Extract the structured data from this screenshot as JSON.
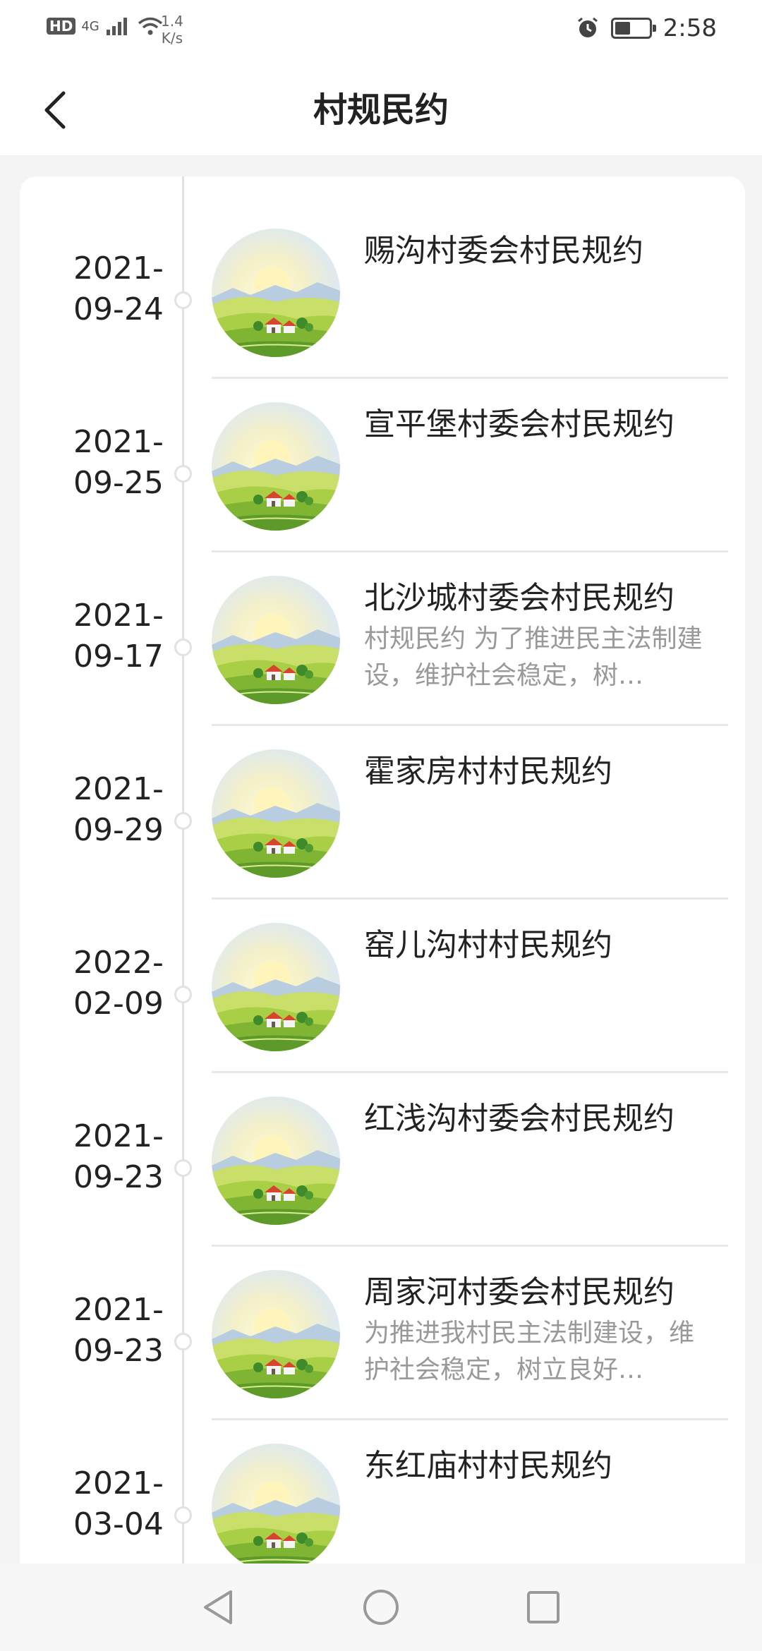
{
  "status_bar": {
    "hd": "HD",
    "network": "4G",
    "speed_value": "1.4",
    "speed_unit": "K/s",
    "time": "2:58",
    "battery_level": 0.45
  },
  "header": {
    "title": "村规民约",
    "back_icon": "chevron-left-icon"
  },
  "items": [
    {
      "date": "2021-\n09-24",
      "title": "赐沟村委会村民规约",
      "desc": ""
    },
    {
      "date": "2021-\n09-25",
      "title": "宣平堡村委会村民规约",
      "desc": ""
    },
    {
      "date": "2021-\n09-17",
      "title": "北沙城村委会村民规约",
      "desc": "村规民约 为了推进民主法制建设，维护社会稳定，树…"
    },
    {
      "date": "2021-\n09-29",
      "title": "霍家房村村民规约",
      "desc": ""
    },
    {
      "date": "2022-\n02-09",
      "title": "窑儿沟村村民规约",
      "desc": ""
    },
    {
      "date": "2021-\n09-23",
      "title": "红浅沟村委会村民规约",
      "desc": ""
    },
    {
      "date": "2021-\n09-23",
      "title": "周家河村委会村民规约",
      "desc": "为推进我村民主法制建设，维护社会稳定，树立良好…"
    },
    {
      "date": "2021-\n03-04",
      "title": "东红庙村村民规约",
      "desc": ""
    }
  ],
  "nav": {
    "back_icon": "triangle-back-icon",
    "home_icon": "circle-home-icon",
    "recents_icon": "square-recents-icon"
  },
  "colors": {
    "accent": "#222222",
    "muted_text": "#999999",
    "timeline": "#e2e2e2"
  }
}
